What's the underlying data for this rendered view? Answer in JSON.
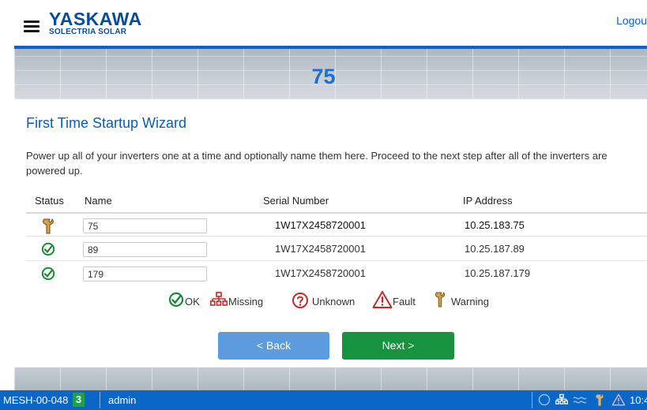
{
  "header": {
    "brand": "YASKAWA",
    "brand_sub": "SOLECTRIA SOLAR",
    "logout": "Logou"
  },
  "banner": {
    "title": "75"
  },
  "wizard": {
    "title": "First Time Startup Wizard",
    "instructions": "Power up all of your inverters one at a time and optionally name them here. Proceed to the next step after all of the inverters are powered up."
  },
  "table": {
    "headers": {
      "status": "Status",
      "name": "Name",
      "serial": "Serial Number",
      "ip": "IP Address"
    },
    "rows": [
      {
        "status": "warning",
        "name": "75",
        "serial": "1W17X2458720001",
        "ip": "10.25.183.75"
      },
      {
        "status": "ok",
        "name": "89",
        "serial": "1W17X2458720001",
        "ip": "10.25.187.89"
      },
      {
        "status": "ok",
        "name": "179",
        "serial": "1W17X2458720001",
        "ip": "10.25.187.179"
      }
    ]
  },
  "legend": {
    "ok": "OK",
    "missing": "Missing",
    "unknown": "Unknown",
    "fault": "Fault",
    "warning": "Warning"
  },
  "buttons": {
    "back": "< Back",
    "next": "Next >"
  },
  "statusbar": {
    "device": "MESH-00-048",
    "count": "3",
    "user": "admin",
    "time": "10:4"
  },
  "colors": {
    "brand_blue": "#0a4b97",
    "accent_blue": "#0a63c8",
    "ok_green": "#1a8a3a",
    "next_green": "#17923f",
    "back_blue": "#5b9bde",
    "fault_red": "#c42a2a",
    "warning_brown": "#8a5a1e"
  }
}
